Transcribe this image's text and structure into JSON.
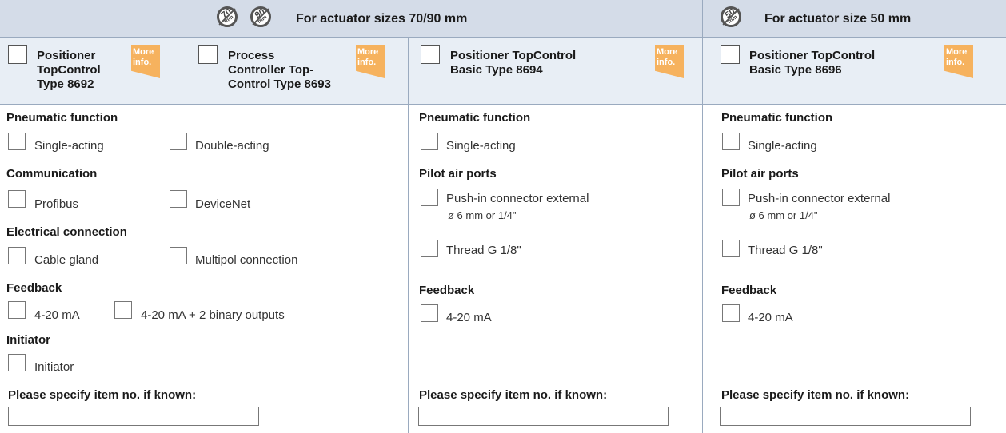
{
  "header": {
    "left_title": "For actuator sizes 70/90 mm",
    "right_title": "For actuator size 50 mm",
    "icons": [
      {
        "name": "70-mm-icon",
        "number": "70",
        "unit": "mm"
      },
      {
        "name": "90-mm-icon",
        "number": "90",
        "unit": "mm"
      },
      {
        "name": "50-mm-icon",
        "number": "50",
        "unit": "mm"
      }
    ]
  },
  "more_info": "More info.",
  "products": {
    "p8692": {
      "line1": "Positioner",
      "line2": "TopControl",
      "line3": "Type 8692"
    },
    "p8693": {
      "line1": "Process",
      "line2": "Controller Top-",
      "line3": "Control Type 8693"
    },
    "p8694": {
      "line1": "Positioner TopControl",
      "line2": "Basic Type 8694"
    },
    "p8696": {
      "line1": "Positioner TopControl",
      "line2": "Basic Type 8696"
    }
  },
  "col1": {
    "pneumatic_title": "Pneumatic function",
    "single_acting": "Single-acting",
    "double_acting": "Double-acting",
    "communication_title": "Communication",
    "profibus": "Profibus",
    "devicenet": "DeviceNet",
    "electrical_title": "Electrical connection",
    "cable_gland": "Cable gland",
    "multipol": "Multipol connection",
    "feedback_title": "Feedback",
    "fb_420": "4-20 mA",
    "fb_420_binary": "4-20 mA + 2 binary outputs",
    "initiator_title": "Initiator",
    "initiator": "Initiator",
    "item_label": "Please specify item no. if known:"
  },
  "col2": {
    "pneumatic_title": "Pneumatic function",
    "single_acting": "Single-acting",
    "pilot_title": "Pilot air ports",
    "push_in_1": "Push-in connector external",
    "push_in_2": "ø 6 mm or 1/4\"",
    "thread": "Thread G 1/8\"",
    "feedback_title": "Feedback",
    "fb_420": "4-20 mA",
    "item_label": "Please specify item no. if known:"
  },
  "col3": {
    "pneumatic_title": "Pneumatic function",
    "single_acting": "Single-acting",
    "pilot_title": "Pilot air ports",
    "push_in_1": "Push-in connector external",
    "push_in_2": "ø 6 mm or 1/4\"",
    "thread": "Thread G 1/8\"",
    "feedback_title": "Feedback",
    "fb_420": "4-20 mA",
    "item_label": "Please specify item no. if known:"
  },
  "colors": {
    "header_bg": "#d4dce8",
    "sub_bg": "#e8eef5",
    "more_bg": "#f6b25e",
    "rule": "#9aaabf"
  }
}
